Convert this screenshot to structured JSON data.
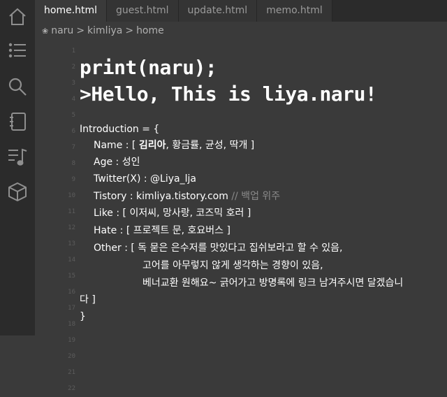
{
  "tabs": [
    {
      "label": "home.html",
      "active": true
    },
    {
      "label": "guest.html",
      "active": false
    },
    {
      "label": "update.html",
      "active": false
    },
    {
      "label": "memo.html",
      "active": false
    }
  ],
  "breadcrumb": {
    "items": [
      "naru",
      "kimliya",
      "home"
    ],
    "separator": ">"
  },
  "sidebar_icons": [
    "home-icon",
    "list-icon",
    "search-icon",
    "notebook-icon",
    "music-list-icon",
    "cube-icon"
  ],
  "line_numbers": [
    "1",
    "2",
    "3",
    "4",
    "5",
    "6",
    "7",
    "8",
    "9",
    "10",
    "11",
    "12",
    "13",
    "14",
    "15",
    "16",
    "17",
    "18",
    "19",
    "20",
    "21",
    "22"
  ],
  "code": {
    "heading1": "print(naru);",
    "heading2": ">Hello, This is liya.naru!",
    "intro": "Introduction = {",
    "name_prefix": "Name : [ ",
    "name_bold": "김리아",
    "name_rest": ", 황금률, 균성, 딱개 ]",
    "age": "Age : 성인",
    "twitter": "Twitter(X) : @Liya_lja",
    "tistory": "Tistory : kimliya.tistory.com ",
    "tistory_comment": "// 백업 위주",
    "like": "Like : [ 이저씨, 망사랑, 코즈믹 호러 ]",
    "hate": "Hate : [ 프로젝트 문, 호요버스 ]",
    "other1": "Other : [ 독 묻은 은수저를 맛있다고 집쉬보라고 할 수 있음,",
    "other2": "고어를 아무렇지 않게 생각하는 경향이 있음,",
    "other3": "베너교환 원해요~ 긁어가고 방명록에 링크 남겨주시면 달겠습니",
    "other4": "다 ]",
    "close": "}"
  },
  "colors": {
    "background": "#3a3a3a",
    "sidebar": "#2b2b2b",
    "comment": "#8a8a8a",
    "line_number": "#5c5c5c"
  }
}
